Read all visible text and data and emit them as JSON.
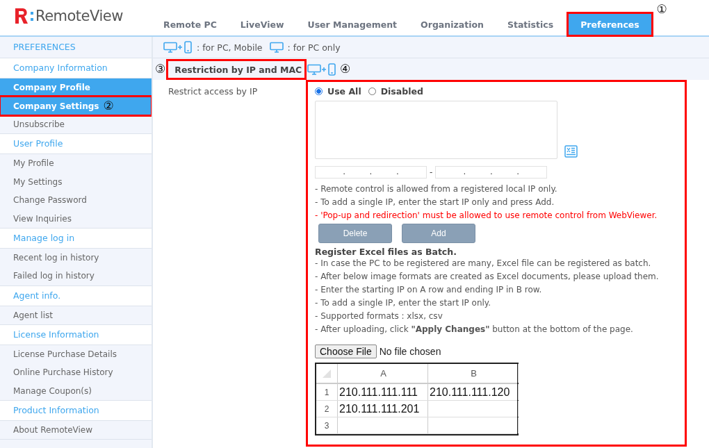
{
  "logo": {
    "text": "RemoteView"
  },
  "tabs": [
    {
      "label": "Remote PC",
      "selected": false
    },
    {
      "label": "LiveView",
      "selected": false
    },
    {
      "label": "User Management",
      "selected": false
    },
    {
      "label": "Organization",
      "selected": false
    },
    {
      "label": "Statistics",
      "selected": false
    },
    {
      "label": "Preferences",
      "selected": true,
      "callout": "①"
    }
  ],
  "sidebar": {
    "title": "PREFERENCES",
    "groups": [
      {
        "label": "Company Information",
        "items": [
          {
            "label": "Company Profile",
            "selected": true
          },
          {
            "label": "Company Settings",
            "selected": true,
            "callout": "②"
          },
          {
            "label": "Unsubscribe",
            "selected": false
          }
        ]
      },
      {
        "label": "User Profile",
        "items": [
          {
            "label": "My Profile",
            "selected": false
          },
          {
            "label": "My Settings",
            "selected": false
          },
          {
            "label": "Change Password",
            "selected": false
          },
          {
            "label": "View Inquiries",
            "selected": false
          }
        ]
      },
      {
        "label": "Manage log in",
        "items": [
          {
            "label": "Recent log in history",
            "selected": false
          },
          {
            "label": "Failed log in history",
            "selected": false
          }
        ]
      },
      {
        "label": "Agent info.",
        "items": [
          {
            "label": "Agent list",
            "selected": false
          }
        ]
      },
      {
        "label": "License Information",
        "items": [
          {
            "label": "License Purchase Details",
            "selected": false
          },
          {
            "label": "Online Purchase History",
            "selected": false
          },
          {
            "label": "Manage Coupon(s)",
            "selected": false
          }
        ]
      },
      {
        "label": "Product Information",
        "items": [
          {
            "label": "About RemoteView",
            "selected": false
          }
        ]
      }
    ]
  },
  "legend": [
    {
      "kind": "pc_mobile",
      "text": ": for PC, Mobile"
    },
    {
      "kind": "pc",
      "text": ": for PC only"
    }
  ],
  "section": {
    "title": "Restriction by IP and MAC",
    "title_callout": "③",
    "kind": "pc_mobile",
    "content_callout": "④"
  },
  "setting": {
    "label": "Restrict access by IP",
    "options": [
      {
        "label": "Use All",
        "selected": true
      },
      {
        "label": "Disabled",
        "selected": false
      }
    ],
    "ip_separator": ".",
    "range_separator": "-",
    "notes": [
      {
        "kind": "normal",
        "text": "- Remote control is allowed from a registered local IP only."
      },
      {
        "kind": "normal",
        "text": "- To add a single IP, enter the start IP only and press Add."
      },
      {
        "kind": "warning",
        "text": "- 'Pop-up and redirection' must be allowed to use remote control from WebViewer."
      }
    ],
    "buttons": [
      "Delete",
      "Add"
    ],
    "batch_title": "Register Excel files as Batch.",
    "batch_notes": [
      "- In case the PC to be registered are many, Excel file can be registered as batch.",
      "- After below image formats are created as Excel documents, please upload them.",
      "- Enter the starting IP on A row and ending IP in B row.",
      "- To add a single IP, enter the start IP only.",
      "- Supported formats : xlsx, csv",
      "- After uploading, click **\"Apply Changes\"** button at the bottom of the page."
    ],
    "file_button": "Choose File",
    "file_status": "No file chosen",
    "sheet": {
      "columns": [
        "A",
        "B"
      ],
      "rows": [
        {
          "number": "1",
          "cells": [
            "210.111.111.111",
            "210.111.111.120"
          ]
        },
        {
          "number": "2",
          "cells": [
            "210.111.111.201"
          ]
        },
        {
          "number": "3",
          "cells": []
        }
      ]
    }
  }
}
